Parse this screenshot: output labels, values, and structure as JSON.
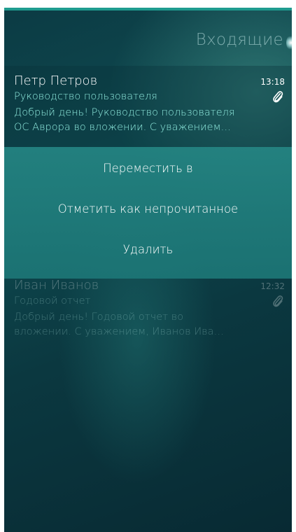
{
  "header": {
    "title": "Входящие"
  },
  "messages": [
    {
      "sender": "Петр Петров",
      "time": "13:18",
      "subject": "Руководство пользователя",
      "preview": "Добрый день! Руководство пользователя\nОС Аврора во вложении. С уважением…",
      "has_attachment": true
    },
    {
      "sender": "Иван Иванов",
      "time": "12:32",
      "subject": "Годовой отчет",
      "preview": "Добрый день! Годовой отчет во\nвложении. С уважением, Иванов Ива…",
      "has_attachment": true
    }
  ],
  "context_menu": {
    "move_label": "Переместить в",
    "mark_unread_label": "Отметить как непрочитанное",
    "delete_label": "Удалить"
  },
  "colors": {
    "accent": "#1f9b8f",
    "highlight_text": "#8fe9dd",
    "menu_background": "#248482"
  },
  "icons": {
    "attachment": "paperclip-icon"
  }
}
